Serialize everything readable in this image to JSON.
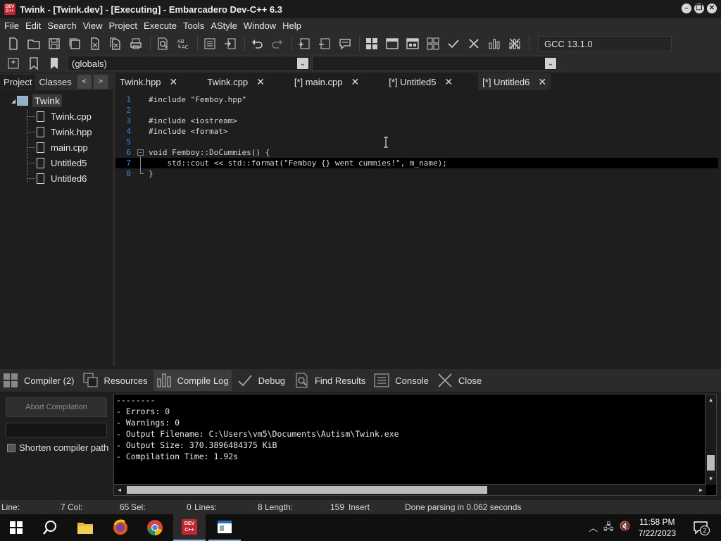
{
  "window": {
    "app_icon_text": "DEV C++",
    "title": "Twink - [Twink.dev] - [Executing] - Embarcadero Dev-C++ 6.3"
  },
  "menu": [
    "File",
    "Edit",
    "Search",
    "View",
    "Project",
    "Execute",
    "Tools",
    "AStyle",
    "Window",
    "Help"
  ],
  "toolbar": {
    "compiler_select": "GCC 13.1.0",
    "scope_select": "(globals)",
    "member_select": ""
  },
  "left_panel": {
    "tabs": [
      "Project",
      "Classes"
    ],
    "tree_root": "Twink",
    "files": [
      "Twink.cpp",
      "Twink.hpp",
      "main.cpp",
      "Untitled5",
      "Untitled6"
    ]
  },
  "editor_tabs": [
    "Twink.hpp",
    "Twink.cpp",
    "[*] main.cpp",
    "[*] Untitled5",
    "[*] Untitled6"
  ],
  "editor": {
    "line_numbers": [
      "1",
      "2",
      "3",
      "4",
      "5",
      "6",
      "7",
      "8"
    ],
    "lines": [
      "#include \"Femboy.hpp\"",
      "",
      "#include <iostream>",
      "#include <format>",
      "",
      "void Femboy::DoCummies() {",
      "    std::cout << std::format(\"Femboy {} went cummies!\", m_name);",
      "}"
    ]
  },
  "bottom_tabs": [
    "Compiler (2)",
    "Resources",
    "Compile Log",
    "Debug",
    "Find Results",
    "Console",
    "Close"
  ],
  "compile_panel": {
    "abort_button": "Abort Compilation",
    "shorten_label": "Shorten compiler path",
    "log": [
      "--------",
      "- Errors: 0",
      "- Warnings: 0",
      "- Output Filename: C:\\Users\\vm5\\Documents\\Autism\\Twink.exe",
      "- Output Size: 370.3896484375 KiB",
      "- Compilation Time: 1.92s"
    ]
  },
  "status": {
    "line_label": "Line:",
    "line_val": "7",
    "col_label": "Col:",
    "col_val": "65",
    "sel_label": "Sel:",
    "sel_val": "0",
    "lines_label": "Lines:",
    "lines_val": "8",
    "length_label": "Length:",
    "length_val": "159",
    "mode": "Insert",
    "message": "Done parsing in 0.062 seconds"
  },
  "taskbar": {
    "time": "11:58 PM",
    "date": "7/22/2023",
    "notification_count": "2"
  }
}
